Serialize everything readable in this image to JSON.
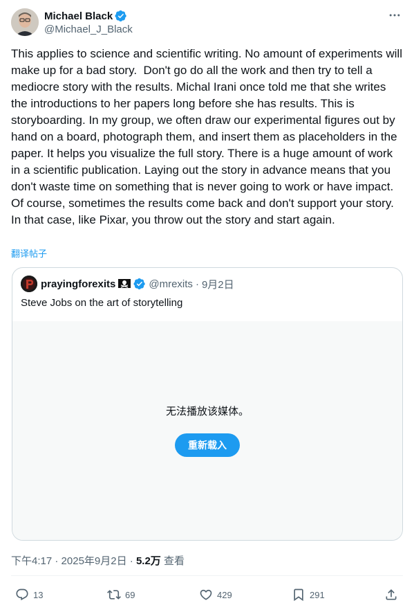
{
  "author": {
    "display_name": "Michael Black",
    "handle": "@Michael_J_Black",
    "verified": true
  },
  "more_icon": "more-horizontal-icon",
  "tweet": {
    "text": "This applies to science and scientific writing. No amount of experiments will make up for a bad story.  Don't go do all the work and then try to tell a mediocre story with the results. Michal Irani once told me that she writes the introductions to her papers long before she has results. This is storyboarding. In my group, we often draw our experimental figures out by hand on a board, photograph them, and insert them as placeholders in the paper. It helps you visualize the full story. There is a huge amount of work in a scientific publication. Laying out the story in advance means that you don't waste time on something that is never going to work or have impact. Of course, sometimes the results come back and don't support your story. In that case, like Pixar, you throw out the story and start again.",
    "translate_label": "翻译帖子"
  },
  "quote": {
    "display_name": "praying4exits",
    "display_name_rendered": "prayingforexits",
    "emoji": "pirate-flag-icon",
    "verified": true,
    "handle": "@mrexits",
    "separator": "·",
    "date": "9月2日",
    "text": "Steve Jobs on the art of storytelling",
    "media_error": "无法播放该媒体。",
    "reload_label": "重新载入"
  },
  "meta": {
    "time": "下午4:17",
    "sep1": " · ",
    "date": "2025年9月2日",
    "sep2": " · ",
    "views_count": "5.2万",
    "views_label": " 查看"
  },
  "actions": {
    "replies": "13",
    "retweets": "69",
    "likes": "429",
    "bookmarks": "291"
  },
  "colors": {
    "accent": "#1d9bf0",
    "text_primary": "#0f1419",
    "text_secondary": "#536471",
    "border": "#cfd9de",
    "media_bg": "#f7f9f9"
  }
}
